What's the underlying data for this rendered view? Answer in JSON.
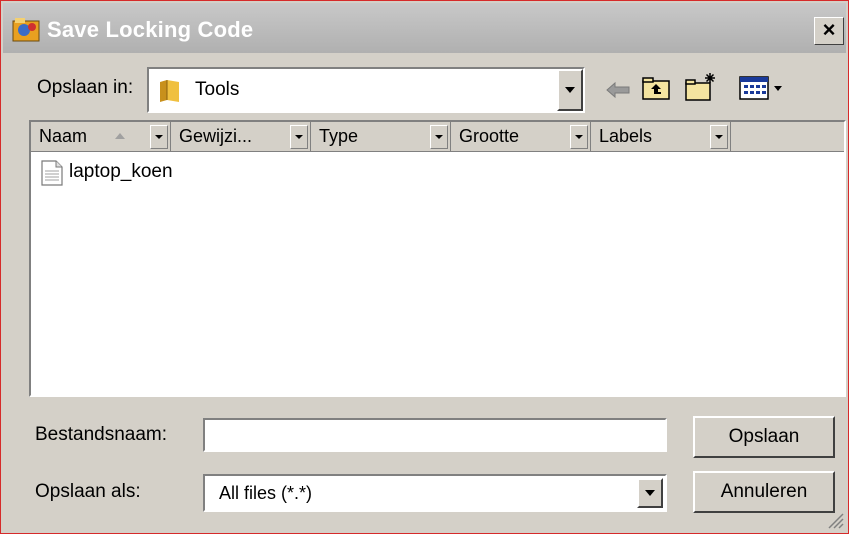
{
  "window": {
    "title": "Save Locking Code",
    "close_label": "×"
  },
  "lookin": {
    "label": "Opslaan in:",
    "value": "Tools"
  },
  "toolbar": {
    "icons": [
      "back-icon",
      "up-folder-icon",
      "new-folder-icon",
      "view-menu-icon"
    ]
  },
  "columns": [
    {
      "label": "Naam"
    },
    {
      "label": "Gewijzi..."
    },
    {
      "label": "Type"
    },
    {
      "label": "Grootte"
    },
    {
      "label": "Labels"
    }
  ],
  "files": [
    {
      "name": "laptop_koen"
    }
  ],
  "filename": {
    "label": "Bestandsnaam:",
    "value": ""
  },
  "filetype": {
    "label": "Opslaan als:",
    "value": "All files (*.*)"
  },
  "buttons": {
    "save": "Opslaan",
    "cancel": "Annuleren"
  },
  "colors": {
    "titlebar": "#b8b8b8",
    "dialog_bg": "#d4d0c8",
    "border_accent": "#d62a2a",
    "folder_yellow": "#e8b830"
  }
}
